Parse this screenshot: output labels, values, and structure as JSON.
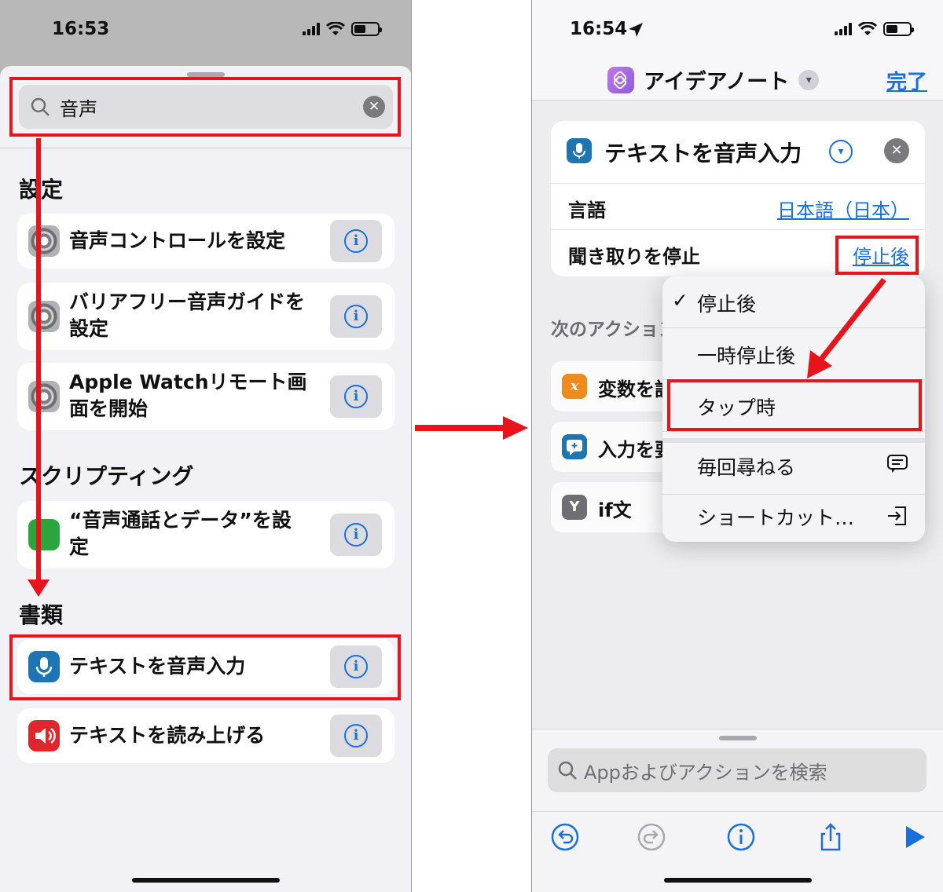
{
  "left": {
    "status_time": "16:53",
    "search_value": "音声",
    "sections": [
      {
        "header": "設定"
      },
      {
        "header": "スクリプティング"
      },
      {
        "header": "書類"
      }
    ],
    "items": [
      {
        "title": "音声コントロールを設定",
        "icon": "settings-gear-icon"
      },
      {
        "title": "バリアフリー音声ガイドを設定",
        "icon": "settings-gear-icon"
      },
      {
        "title": "Apple Watchリモート画面を開始",
        "icon": "settings-gear-icon"
      },
      {
        "title": "“音声通話とデータ”を設定",
        "icon": "cellular-icon"
      },
      {
        "title": "テキストを音声入力",
        "icon": "microphone-icon"
      },
      {
        "title": "テキストを読み上げる",
        "icon": "speaker-icon"
      }
    ],
    "info_glyph": "i"
  },
  "right": {
    "status_time": "16:54",
    "nav_title": "アイデアノート",
    "done_label": "完了",
    "action": {
      "title": "テキストを音声入力",
      "language_label": "言語",
      "language_value": "日本語（日本）",
      "stop_label": "聞き取りを停止",
      "stop_value": "停止後"
    },
    "next_actions_header": "次のアクション",
    "next_actions": [
      {
        "label": "変数を設定",
        "icon": "x"
      },
      {
        "label": "入力を要求",
        "icon": "prompt-icon"
      },
      {
        "label": "if文",
        "icon": "Y"
      }
    ],
    "menu": [
      {
        "label": "停止後",
        "checked": true
      },
      {
        "label": "一時停止後",
        "checked": false
      },
      {
        "label": "タップ時",
        "checked": false
      },
      {
        "label": "毎回尋ねる",
        "checked": false
      },
      {
        "label": "ショートカット…",
        "checked": false
      }
    ],
    "bottom_search_placeholder": "Appおよびアクションを検索"
  },
  "colors": {
    "accent": "#1a6fe0",
    "annotation_red": "#e8141b"
  }
}
